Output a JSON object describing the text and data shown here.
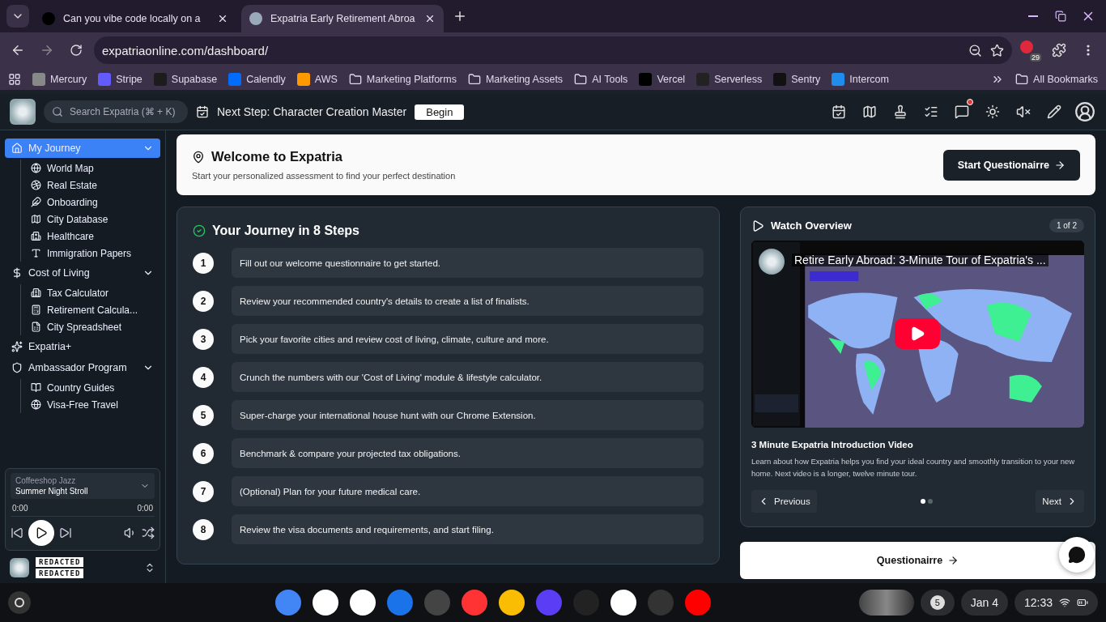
{
  "browser": {
    "tabs": [
      {
        "title": "Can you vibe code locally on a",
        "selected": false
      },
      {
        "title": "Expatria Early Retirement Abroa",
        "selected": true
      }
    ],
    "url": "expatriaonline.com/dashboard/",
    "extension_badge": "29",
    "bookmarks": [
      {
        "label": "Mercury",
        "kind": "site"
      },
      {
        "label": "Stripe",
        "kind": "site"
      },
      {
        "label": "Supabase",
        "kind": "site"
      },
      {
        "label": "Calendly",
        "kind": "site"
      },
      {
        "label": "AWS",
        "kind": "site"
      },
      {
        "label": "Marketing Platforms",
        "kind": "folder"
      },
      {
        "label": "Marketing Assets",
        "kind": "folder"
      },
      {
        "label": "AI Tools",
        "kind": "folder"
      },
      {
        "label": "Vercel",
        "kind": "site"
      },
      {
        "label": "Serverless",
        "kind": "site"
      },
      {
        "label": "Sentry",
        "kind": "site"
      },
      {
        "label": "Intercom",
        "kind": "site"
      }
    ],
    "all_bookmarks": "All Bookmarks"
  },
  "header": {
    "search_placeholder": "Search Expatria (⌘ + K)",
    "next_step": "Next Step: Character Creation Master",
    "begin_button": "Begin",
    "unread_messages": true
  },
  "sidebar": {
    "sections": [
      {
        "label": "My Journey",
        "selected": true,
        "expanded": true,
        "children": [
          {
            "label": "World Map"
          },
          {
            "label": "Real Estate"
          },
          {
            "label": "Onboarding"
          },
          {
            "label": "City Database"
          },
          {
            "label": "Healthcare"
          },
          {
            "label": "Immigration Papers"
          }
        ]
      },
      {
        "label": "Cost of Living",
        "selected": false,
        "expanded": true,
        "children": [
          {
            "label": "Tax Calculator"
          },
          {
            "label": "Retirement Calcula..."
          },
          {
            "label": "City Spreadsheet"
          }
        ]
      },
      {
        "label": "Expatria+",
        "selected": false
      },
      {
        "label": "Ambassador Program",
        "selected": false,
        "expanded": true,
        "children": [
          {
            "label": "Country Guides"
          },
          {
            "label": "Visa-Free Travel"
          }
        ]
      }
    ]
  },
  "player": {
    "playlist": "Coffeeshop Jazz",
    "track": "Summer Night Stroll",
    "elapsed": "0:00",
    "duration": "0:00"
  },
  "user": {
    "lines": [
      "REDACTED",
      "REDACTED"
    ]
  },
  "welcome": {
    "title": "Welcome to Expatria",
    "subtitle": "Start your personalized assessment to find your perfect destination",
    "button": "Start Questionairre"
  },
  "journey": {
    "title": "Your Journey in 8 Steps",
    "steps": [
      {
        "number": "1",
        "text": "Fill out our welcome questionnaire to get started."
      },
      {
        "number": "2",
        "text": "Review your recommended country's details to create a list of finalists."
      },
      {
        "number": "3",
        "text": "Pick your favorite cities and review cost of living, climate, culture and more."
      },
      {
        "number": "4",
        "text": "Crunch the numbers with our 'Cost of Living' module & lifestyle calculator."
      },
      {
        "number": "5",
        "text": "Super-charge your international house hunt with our Chrome Extension."
      },
      {
        "number": "6",
        "text": "Benchmark & compare your projected tax obligations."
      },
      {
        "number": "7",
        "text": "(Optional) Plan for your future medical care."
      },
      {
        "number": "8",
        "text": "Review the visa documents and requirements, and start filing."
      }
    ]
  },
  "video": {
    "title": "Watch Overview",
    "counter": "1 of 2",
    "video_title": "Retire Early Abroad: 3-Minute Tour of Expatria's ...",
    "heading": "3 Minute Expatria Introduction Video",
    "description": "Learn about how Expatria helps you find your ideal country and smoothly transition to your new home. Next video is a longer, twelve minute tour.",
    "previous": "Previous",
    "next": "Next",
    "dots": [
      {
        "selected": true
      },
      {
        "selected": false
      }
    ]
  },
  "questionnaire_button": "Questionairre",
  "shelf": {
    "notifications": "5",
    "date": "Jan 4",
    "time": "12:33"
  }
}
